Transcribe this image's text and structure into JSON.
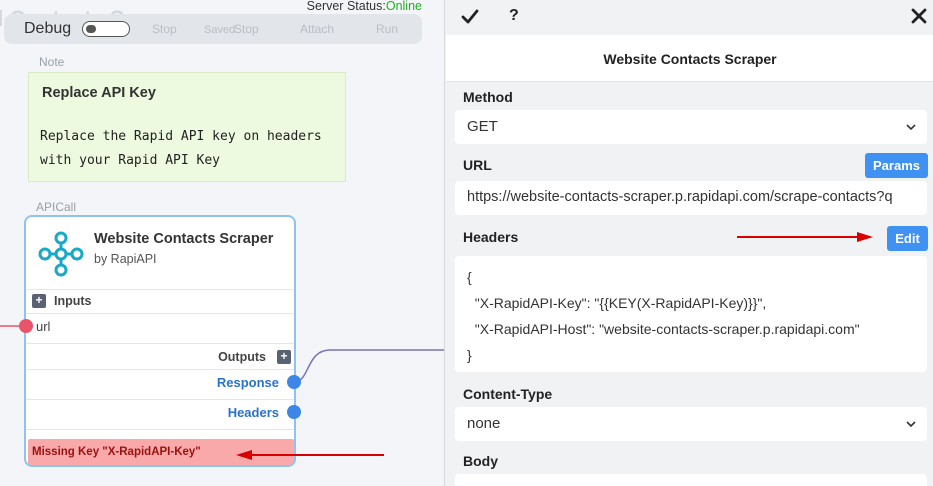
{
  "toolbar": {
    "title": "d Contacts Scraper",
    "debug_label": "Debug",
    "saved_label": "Saved",
    "items": [
      "Stop",
      "Stop",
      "Attach",
      "Run"
    ],
    "server_status_label": "Server Status:",
    "server_status_value": "Online"
  },
  "note": {
    "caption": "Note",
    "title": "Replace API Key",
    "body": "Replace the Rapid API key on headers with your Rapid API Key"
  },
  "api_node": {
    "caption": "APICall",
    "title": "Website Contacts Scraper",
    "subtitle": "by RapiAPI",
    "inputs_label": "Inputs",
    "input_url": "url",
    "outputs_label": "Outputs",
    "output_response": "Response",
    "output_headers": "Headers",
    "error": "Missing Key \"X-RapidAPI-Key\""
  },
  "panel": {
    "title": "Website Contacts Scraper",
    "help_label": "?",
    "method_label": "Method",
    "method_value": "GET",
    "url_label": "URL",
    "params_button": "Params",
    "url_value": "https://website-contacts-scraper.p.rapidapi.com/scrape-contacts?q",
    "headers_label": "Headers",
    "edit_button": "Edit",
    "headers_code": "{\n  \"X-RapidAPI-Key\": \"{{KEY(X-RapidAPI-Key)}}\",\n  \"X-RapidAPI-Host\": \"website-contacts-scraper.p.rapidapi.com\"\n}",
    "content_type_label": "Content-Type",
    "content_type_value": "none",
    "body_label": "Body"
  },
  "colors": {
    "accent_blue": "#3f91f2",
    "online_green": "#1fb31f",
    "error_bg": "#f9a9a9",
    "annotation_red": "#d80000",
    "note_bg": "#eefadf"
  }
}
